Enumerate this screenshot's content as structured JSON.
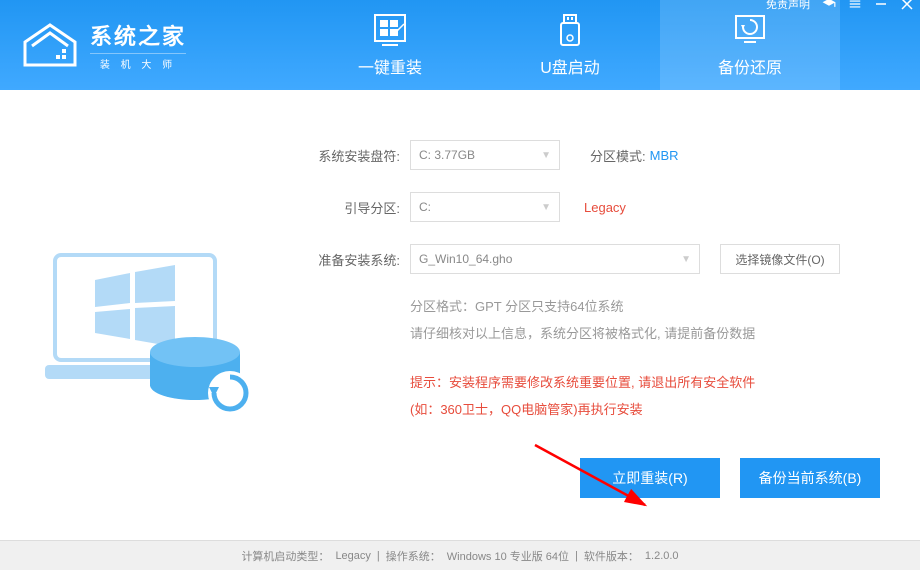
{
  "titlebar": {
    "disclaimer": "免责声明"
  },
  "logo": {
    "title": "系统之家",
    "subtitle": "装 机 大 师"
  },
  "tabs": {
    "reinstall": "一键重装",
    "usb": "U盘启动",
    "backup": "备份还原"
  },
  "form": {
    "disk_label": "系统安装盘符:",
    "disk_value": "C: 3.77GB",
    "mode_label": "分区模式:",
    "mode_value": "MBR",
    "boot_label": "引导分区:",
    "boot_value": "C:",
    "legacy": "Legacy",
    "sys_label": "准备安装系统:",
    "sys_value": "G_Win10_64.gho",
    "file_btn": "选择镜像文件(O)"
  },
  "info": {
    "line1": "分区格式：GPT 分区只支持64位系统",
    "line2": "请仔细核对以上信息，系统分区将被格式化, 请提前备份数据",
    "warn1": "提示：安装程序需要修改系统重要位置, 请退出所有安全软件",
    "warn2": "(如：360卫士，QQ电脑管家)再执行安装"
  },
  "actions": {
    "reinstall": "立即重装(R)",
    "backup": "备份当前系统(B)"
  },
  "status": {
    "boot_type_label": "计算机启动类型：",
    "boot_type": "Legacy",
    "os_label": "操作系统：",
    "os": "Windows 10 专业版 64位",
    "ver_label": "软件版本：",
    "ver": "1.2.0.0"
  }
}
